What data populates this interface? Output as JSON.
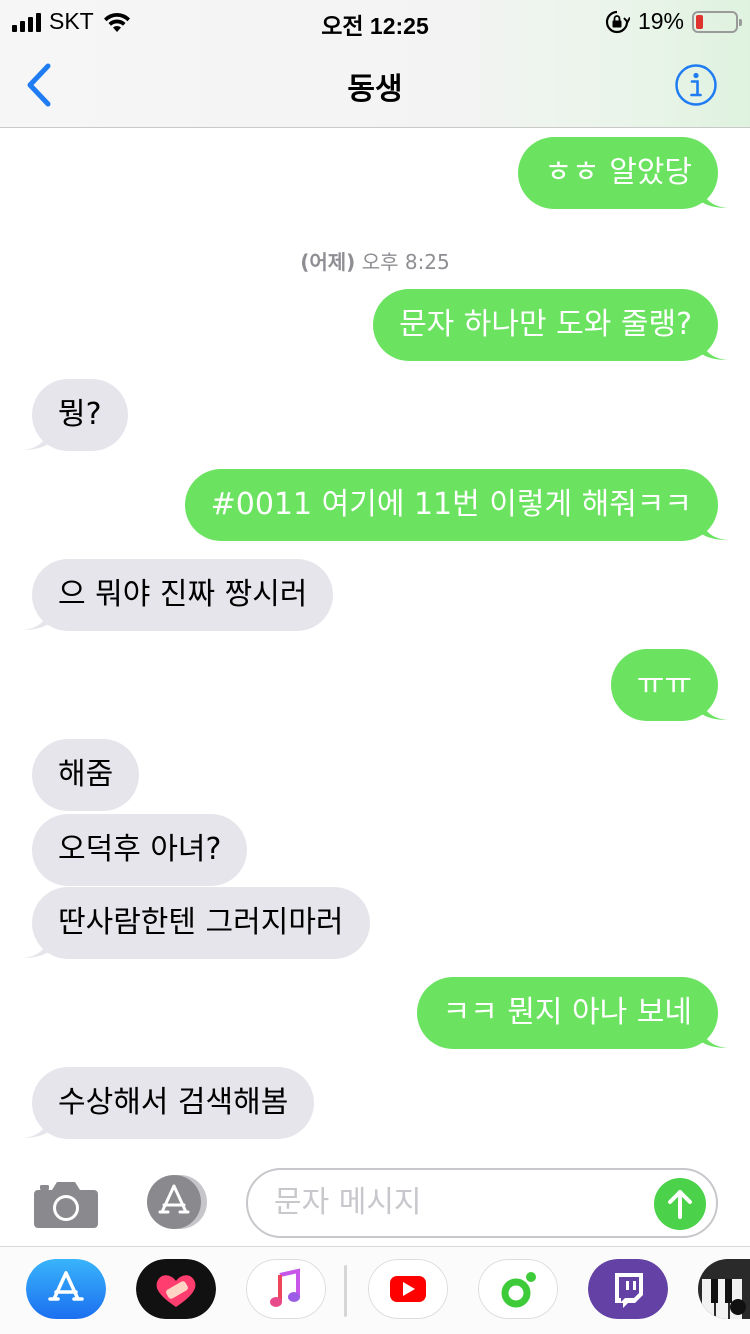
{
  "status_bar": {
    "carrier": "SKT",
    "time": "오전 12:25",
    "battery_percent": "19%",
    "battery_level": 0.19,
    "icons": [
      "signal-icon",
      "wifi-icon",
      "rotation-lock-icon",
      "battery-icon"
    ]
  },
  "header": {
    "back_icon": "chevron-left-icon",
    "title": "동생",
    "info_icon": "info-icon"
  },
  "thread": {
    "timestamp_day": "(어제)",
    "timestamp_time": "오후 8:25",
    "messages": [
      {
        "from": "me",
        "text": "ㅎㅎ 알았당"
      },
      {
        "from": "me",
        "text": "문자 하나만 도와 줄랭?"
      },
      {
        "from": "them",
        "text": "뭥?"
      },
      {
        "from": "me",
        "text": "#0011 여기에 11번 이렇게 해줘ㅋㅋ"
      },
      {
        "from": "them",
        "text": "으 뭐야 진짜 짱시러"
      },
      {
        "from": "me",
        "text": "ㅠㅠ"
      },
      {
        "from": "them",
        "text": "해줌"
      },
      {
        "from": "them",
        "text": "오덕후 아녀?"
      },
      {
        "from": "them",
        "text": "딴사람한텐 그러지마러"
      },
      {
        "from": "me",
        "text": "ㅋㅋ 뭔지 아나 보네"
      },
      {
        "from": "them",
        "text": "수상해서 검색해봄"
      }
    ]
  },
  "input_bar": {
    "camera_icon": "camera-icon",
    "apps_icon": "app-store-icon",
    "placeholder": "문자 메시지",
    "send_icon": "arrow-up-icon"
  },
  "app_drawer": {
    "apps": [
      "app-store-icon",
      "heart-sticker-icon",
      "music-icon",
      "youtube-icon",
      "green-circle-app-icon",
      "twitch-icon",
      "piano-icon"
    ]
  },
  "colors": {
    "sent_bubble": "#6be361",
    "received_bubble": "#e6e5eb",
    "accent_blue": "#1f7cf2",
    "send_button": "#4cd24a"
  }
}
